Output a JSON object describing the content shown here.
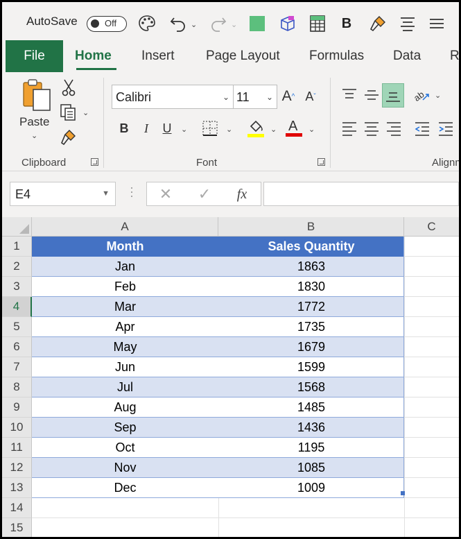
{
  "titlebar": {
    "autosave_label": "AutoSave",
    "autosave_state": "Off",
    "qat_icons": [
      "palette-icon",
      "undo-icon",
      "redo-icon",
      "fill-square-icon",
      "3d-box-icon",
      "table-icon",
      "bold-icon",
      "format-painter-icon",
      "align-center-icon",
      "align-lines-icon"
    ]
  },
  "tabs": [
    {
      "label": "File"
    },
    {
      "label": "Home",
      "active": true
    },
    {
      "label": "Insert"
    },
    {
      "label": "Page Layout"
    },
    {
      "label": "Formulas"
    },
    {
      "label": "Data"
    },
    {
      "label": "R"
    }
  ],
  "ribbon": {
    "clipboard": {
      "paste_label": "Paste",
      "group_label": "Clipboard"
    },
    "font": {
      "font_name": "Calibri",
      "font_size": "11",
      "group_label": "Font"
    },
    "alignment": {
      "group_label": "Alignm"
    }
  },
  "formula_bar": {
    "name_box": "E4",
    "fx_label": "fx",
    "formula": ""
  },
  "sheet": {
    "columns": [
      "A",
      "B",
      "C"
    ],
    "row_numbers": [
      "1",
      "2",
      "3",
      "4",
      "5",
      "6",
      "7",
      "8",
      "9",
      "10",
      "11",
      "12",
      "13",
      "14",
      "15"
    ],
    "selected_row": "4",
    "header": {
      "month": "Month",
      "sales": "Sales Quantity"
    },
    "rows": [
      {
        "month": "Jan",
        "sales": "1863"
      },
      {
        "month": "Feb",
        "sales": "1830"
      },
      {
        "month": "Mar",
        "sales": "1772"
      },
      {
        "month": "Apr",
        "sales": "1735"
      },
      {
        "month": "May",
        "sales": "1679"
      },
      {
        "month": "Jun",
        "sales": "1599"
      },
      {
        "month": "Jul",
        "sales": "1568"
      },
      {
        "month": "Aug",
        "sales": "1485"
      },
      {
        "month": "Sep",
        "sales": "1436"
      },
      {
        "month": "Oct",
        "sales": "1195"
      },
      {
        "month": "Nov",
        "sales": "1085"
      },
      {
        "month": "Dec",
        "sales": "1009"
      }
    ]
  },
  "colors": {
    "excel_green": "#217346",
    "table_header": "#4472c4",
    "table_band": "#d9e1f2",
    "highlight_yellow": "#ffff00",
    "font_red": "#e00000"
  }
}
